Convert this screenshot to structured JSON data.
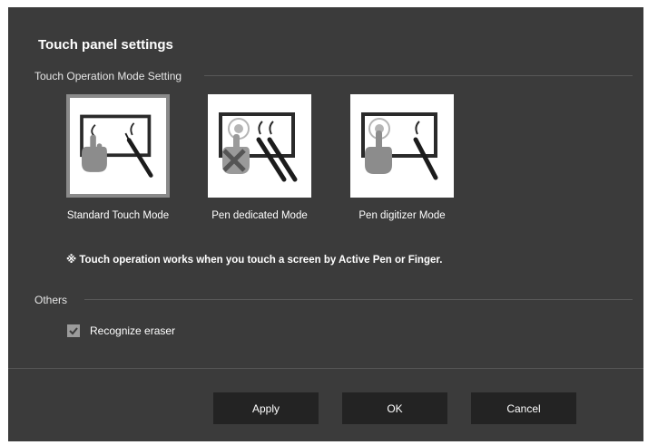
{
  "dialog": {
    "title": "Touch panel settings"
  },
  "touch_mode": {
    "section_label": "Touch Operation Mode Setting",
    "modes": [
      {
        "label": "Standard Touch Mode",
        "icon": "touch-and-pen-icon",
        "selected": true
      },
      {
        "label": "Pen dedicated Mode",
        "icon": "pen-only-icon",
        "selected": false
      },
      {
        "label": "Pen digitizer Mode",
        "icon": "pen-digitizer-icon",
        "selected": false
      }
    ],
    "note": "※ Touch operation works when you touch a screen by Active Pen or Finger."
  },
  "others": {
    "section_label": "Others",
    "recognize_eraser": {
      "label": "Recognize eraser",
      "checked": true
    }
  },
  "buttons": {
    "apply": "Apply",
    "ok": "OK",
    "cancel": "Cancel"
  },
  "colors": {
    "dialog_background": "#3b3b3b",
    "button_background": "#232323",
    "selection_border": "#8a8a8a",
    "checkbox": "#9b9b9b"
  }
}
